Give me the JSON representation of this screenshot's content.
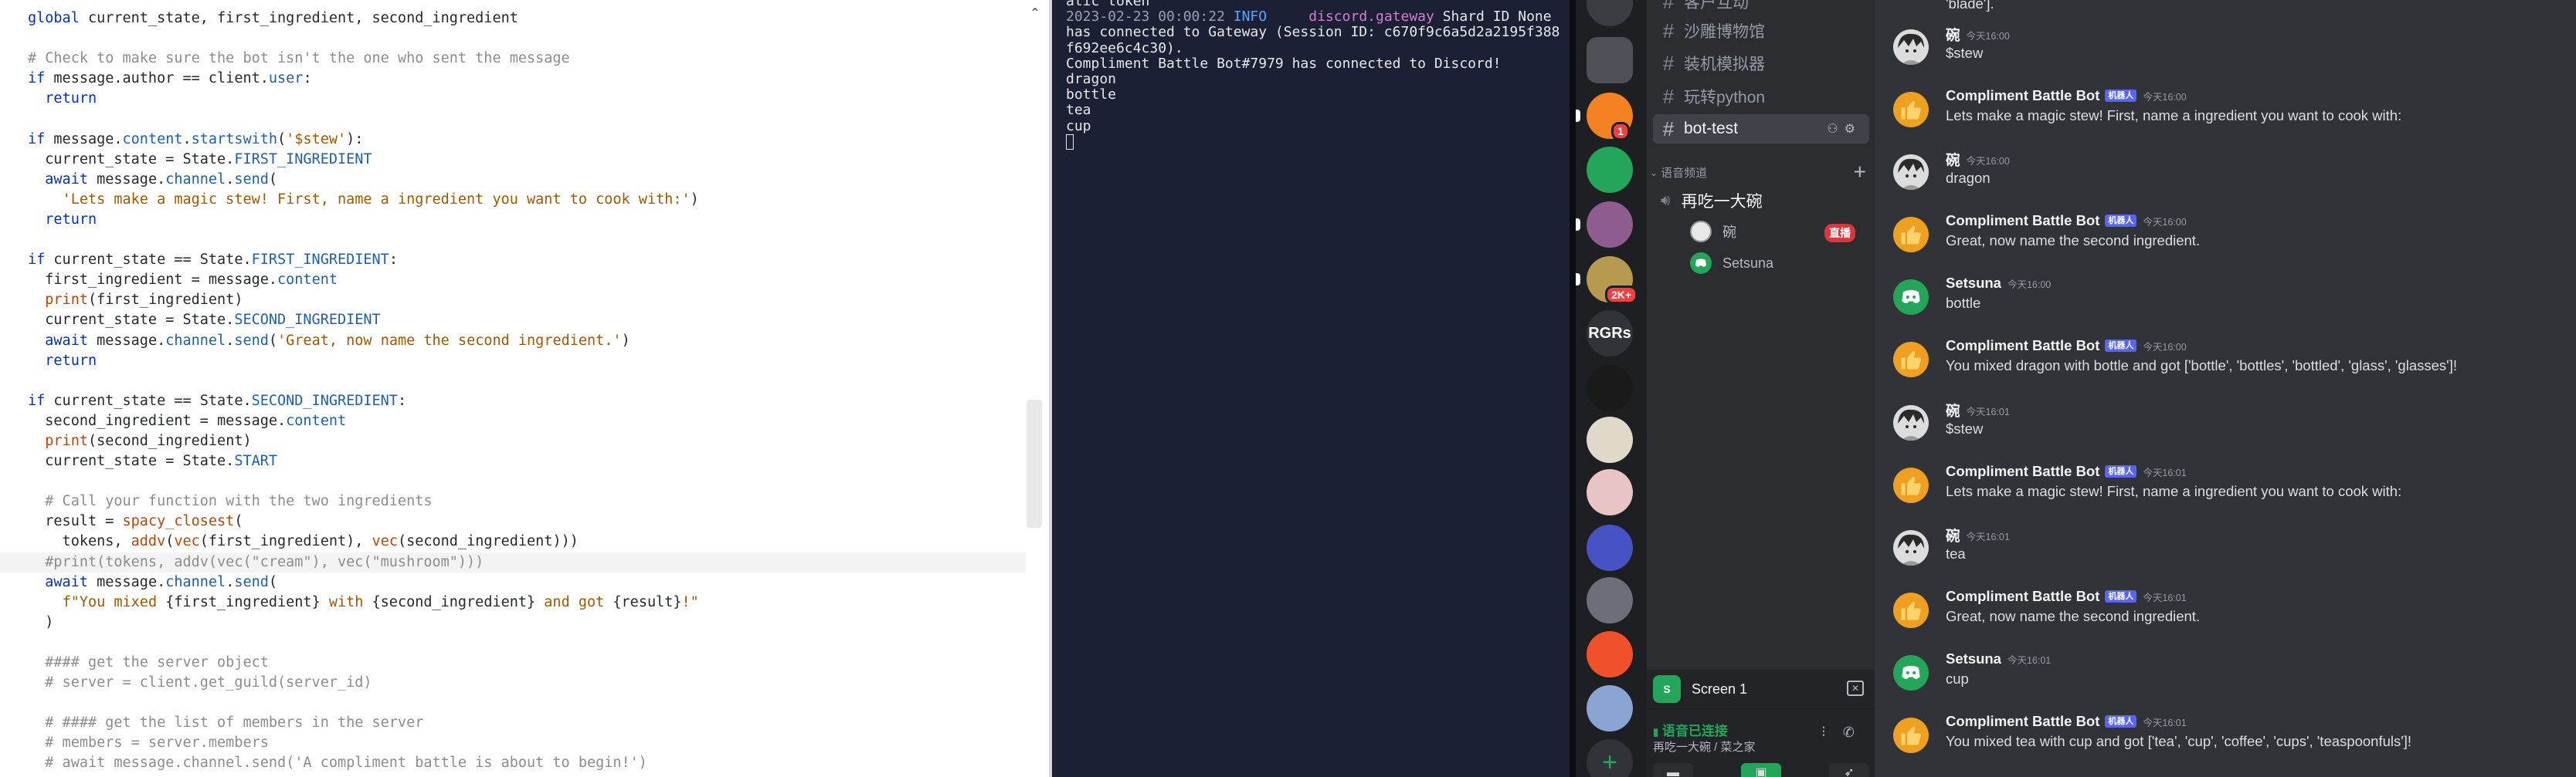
{
  "editor": {
    "lines": [
      [
        [
          "k",
          "global"
        ],
        [
          "t",
          " current_state, first_ingredient, second_ingredient"
        ]
      ],
      [
        [
          "t",
          ""
        ]
      ],
      [
        [
          "c",
          "# Check to make sure the bot isn't the one who sent the message"
        ]
      ],
      [
        [
          "k",
          "if"
        ],
        [
          "t",
          " message.author == client."
        ],
        [
          "a",
          "user"
        ],
        [
          "t",
          ":"
        ]
      ],
      [
        [
          "t",
          "  "
        ],
        [
          "k",
          "return"
        ]
      ],
      [
        [
          "t",
          ""
        ]
      ],
      [
        [
          "k",
          "if"
        ],
        [
          "t",
          " message."
        ],
        [
          "a",
          "content"
        ],
        [
          "t",
          "."
        ],
        [
          "a",
          "startswith"
        ],
        [
          "t",
          "("
        ],
        [
          "s",
          "'$stew'"
        ],
        [
          "t",
          "):"
        ]
      ],
      [
        [
          "t",
          "  current_state = State."
        ],
        [
          "a",
          "FIRST_INGREDIENT"
        ]
      ],
      [
        [
          "t",
          "  "
        ],
        [
          "k",
          "await"
        ],
        [
          "t",
          " message."
        ],
        [
          "a",
          "channel"
        ],
        [
          "t",
          "."
        ],
        [
          "a",
          "send"
        ],
        [
          "t",
          "("
        ]
      ],
      [
        [
          "t",
          "    "
        ],
        [
          "s",
          "'Lets make a magic stew! First, name a ingredient you want to cook with:'"
        ],
        [
          "t",
          ")"
        ]
      ],
      [
        [
          "t",
          "  "
        ],
        [
          "k",
          "return"
        ]
      ],
      [
        [
          "t",
          ""
        ]
      ],
      [
        [
          "k",
          "if"
        ],
        [
          "t",
          " current_state == State."
        ],
        [
          "a",
          "FIRST_INGREDIENT"
        ],
        [
          "t",
          ":"
        ]
      ],
      [
        [
          "t",
          "  first_ingredient = message."
        ],
        [
          "a",
          "content"
        ]
      ],
      [
        [
          "t",
          "  "
        ],
        [
          "f",
          "print"
        ],
        [
          "t",
          "(first_ingredient)"
        ]
      ],
      [
        [
          "t",
          "  current_state = State."
        ],
        [
          "a",
          "SECOND_INGREDIENT"
        ]
      ],
      [
        [
          "t",
          "  "
        ],
        [
          "k",
          "await"
        ],
        [
          "t",
          " message."
        ],
        [
          "a",
          "channel"
        ],
        [
          "t",
          "."
        ],
        [
          "a",
          "send"
        ],
        [
          "t",
          "("
        ],
        [
          "s",
          "'Great, now name the second ingredient.'"
        ],
        [
          "t",
          ")"
        ]
      ],
      [
        [
          "t",
          "  "
        ],
        [
          "k",
          "return"
        ]
      ],
      [
        [
          "t",
          ""
        ]
      ],
      [
        [
          "k",
          "if"
        ],
        [
          "t",
          " current_state == State."
        ],
        [
          "a",
          "SECOND_INGREDIENT"
        ],
        [
          "t",
          ":"
        ]
      ],
      [
        [
          "t",
          "  second_ingredient = message."
        ],
        [
          "a",
          "content"
        ]
      ],
      [
        [
          "t",
          "  "
        ],
        [
          "f",
          "print"
        ],
        [
          "t",
          "(second_ingredient)"
        ]
      ],
      [
        [
          "t",
          "  current_state = State."
        ],
        [
          "a",
          "START"
        ]
      ],
      [
        [
          "t",
          ""
        ]
      ],
      [
        [
          "t",
          "  "
        ],
        [
          "c",
          "# Call your function with the two ingredients"
        ]
      ],
      [
        [
          "t",
          "  result = "
        ],
        [
          "f",
          "spacy_closest"
        ],
        [
          "t",
          "("
        ]
      ],
      [
        [
          "t",
          "    tokens, "
        ],
        [
          "f",
          "addv"
        ],
        [
          "t",
          "("
        ],
        [
          "f",
          "vec"
        ],
        [
          "t",
          "(first_ingredient), "
        ],
        [
          "f",
          "vec"
        ],
        [
          "t",
          "(second_ingredient)))"
        ]
      ],
      [
        [
          "t",
          "  "
        ],
        [
          "c",
          "#print(tokens, addv(vec(\"cream\"), vec(\"mushroom\")))"
        ]
      ],
      [
        [
          "t",
          "  "
        ],
        [
          "k",
          "await"
        ],
        [
          "t",
          " message."
        ],
        [
          "a",
          "channel"
        ],
        [
          "t",
          "."
        ],
        [
          "a",
          "send"
        ],
        [
          "t",
          "("
        ]
      ],
      [
        [
          "t",
          "    "
        ],
        [
          "s",
          "f\"You mixed "
        ],
        [
          "t",
          "{first_ingredient}"
        ],
        [
          "s",
          " with "
        ],
        [
          "t",
          "{second_ingredient}"
        ],
        [
          "s",
          " and got "
        ],
        [
          "t",
          "{result}"
        ],
        [
          "s",
          "!\""
        ]
      ],
      [
        [
          "t",
          "  )"
        ]
      ],
      [
        [
          "t",
          ""
        ]
      ],
      [
        [
          "t",
          "  "
        ],
        [
          "c",
          "#### get the server object"
        ]
      ],
      [
        [
          "t",
          "  "
        ],
        [
          "c",
          "# server = client.get_guild(server_id)"
        ]
      ],
      [
        [
          "t",
          ""
        ]
      ],
      [
        [
          "t",
          "  "
        ],
        [
          "c",
          "# #### get the list of members in the server"
        ]
      ],
      [
        [
          "t",
          "  "
        ],
        [
          "c",
          "# members = server.members"
        ]
      ],
      [
        [
          "t",
          "  "
        ],
        [
          "c",
          "# await message.channel.send('A compliment battle is about to begin!')"
        ]
      ]
    ],
    "current_line": 27,
    "fold_icon": "chevron-up-icon"
  },
  "terminal": {
    "line_atic": "atic token",
    "log_timestamp": "2023-02-23 00:00:22",
    "log_level": "INFO",
    "log_source": "discord.gateway",
    "log_message": "Shard ID None has connected to Gateway (Session ID: c670f9c6a5d2a2195f388f692ee6c4c30).",
    "lines": [
      "Compliment Battle Bot#7979 has connected to Discord!",
      "dragon",
      "bottle",
      "tea",
      "cup"
    ]
  },
  "server_rail": {
    "servers": [
      {
        "label": "",
        "color": "#3a3c42"
      },
      {
        "label": "",
        "color": "#4e5058"
      },
      {
        "label": "",
        "color": "#f48221",
        "badge": "1"
      },
      {
        "label": "",
        "color": "#23a55a"
      },
      {
        "label": "",
        "color": "#8e5c8e"
      },
      {
        "label": "",
        "color": "#b59a4f",
        "badge": "2K+"
      },
      {
        "label": "RGRs",
        "color": "#313338"
      },
      {
        "label": "",
        "color": "#1a1a1a"
      },
      {
        "label": "",
        "color": "#e0d9c9"
      },
      {
        "label": "",
        "color": "#e9c4c4"
      },
      {
        "label": "",
        "color": "#4752c4"
      },
      {
        "label": "",
        "color": "#6d6f78"
      },
      {
        "label": "",
        "color": "#f0502a"
      },
      {
        "label": "",
        "color": "#8aa5d4"
      }
    ],
    "add_label": "+"
  },
  "channels": {
    "text": [
      {
        "name": "客户互动",
        "active": false
      },
      {
        "name": "沙雕博物馆",
        "active": false
      },
      {
        "name": "装机模拟器",
        "active": false
      },
      {
        "name": "玩转python",
        "active": false
      },
      {
        "name": "bot-test",
        "active": true
      }
    ],
    "voice_category": "语音频道",
    "voice_channel": "再吃一大碗",
    "voice_users": [
      {
        "name": "碗",
        "live": true
      },
      {
        "name": "Setsuna",
        "live": false
      }
    ],
    "live_label": "直播",
    "stream_title": "Screen 1",
    "stream_icon_label": "S",
    "voice_status": "语音已连接",
    "voice_location": "再吃一大碗 / 菜之家"
  },
  "chat": {
    "top_fragment": "'blade'].",
    "messages": [
      {
        "author": "碗",
        "bot": false,
        "time": "今天16:00",
        "text": "$stew",
        "avatar": "user"
      },
      {
        "author": "Compliment Battle Bot",
        "bot": true,
        "time": "今天16:00",
        "text": "Lets make a magic stew! First, name a ingredient you want to cook with:",
        "avatar": "bot"
      },
      {
        "author": "碗",
        "bot": false,
        "time": "今天16:00",
        "text": "dragon",
        "avatar": "user"
      },
      {
        "author": "Compliment Battle Bot",
        "bot": true,
        "time": "今天16:00",
        "text": "Great, now name the second ingredient.",
        "avatar": "bot"
      },
      {
        "author": "Setsuna",
        "bot": false,
        "time": "今天16:00",
        "text": "bottle",
        "avatar": "discord"
      },
      {
        "author": "Compliment Battle Bot",
        "bot": true,
        "time": "今天16:00",
        "text": "You mixed dragon with bottle and got ['bottle', 'bottles', 'bottled', 'glass', 'glasses']!",
        "avatar": "bot"
      },
      {
        "author": "碗",
        "bot": false,
        "time": "今天16:01",
        "text": "$stew",
        "avatar": "user"
      },
      {
        "author": "Compliment Battle Bot",
        "bot": true,
        "time": "今天16:01",
        "text": "Lets make a magic stew! First, name a ingredient you want to cook with:",
        "avatar": "bot"
      },
      {
        "author": "碗",
        "bot": false,
        "time": "今天16:01",
        "text": "tea",
        "avatar": "user"
      },
      {
        "author": "Compliment Battle Bot",
        "bot": true,
        "time": "今天16:01",
        "text": "Great, now name the second ingredient.",
        "avatar": "bot"
      },
      {
        "author": "Setsuna",
        "bot": false,
        "time": "今天16:01",
        "text": "cup",
        "avatar": "discord"
      },
      {
        "author": "Compliment Battle Bot",
        "bot": true,
        "time": "今天16:01",
        "text": "You mixed tea with cup and got ['tea', 'cup', 'coffee', 'cups', 'teaspoonfuls']!",
        "avatar": "bot"
      }
    ],
    "bot_tag": "机器人"
  },
  "colors": {
    "accent": "#5865f2",
    "online": "#23a55a",
    "danger": "#da373c"
  }
}
